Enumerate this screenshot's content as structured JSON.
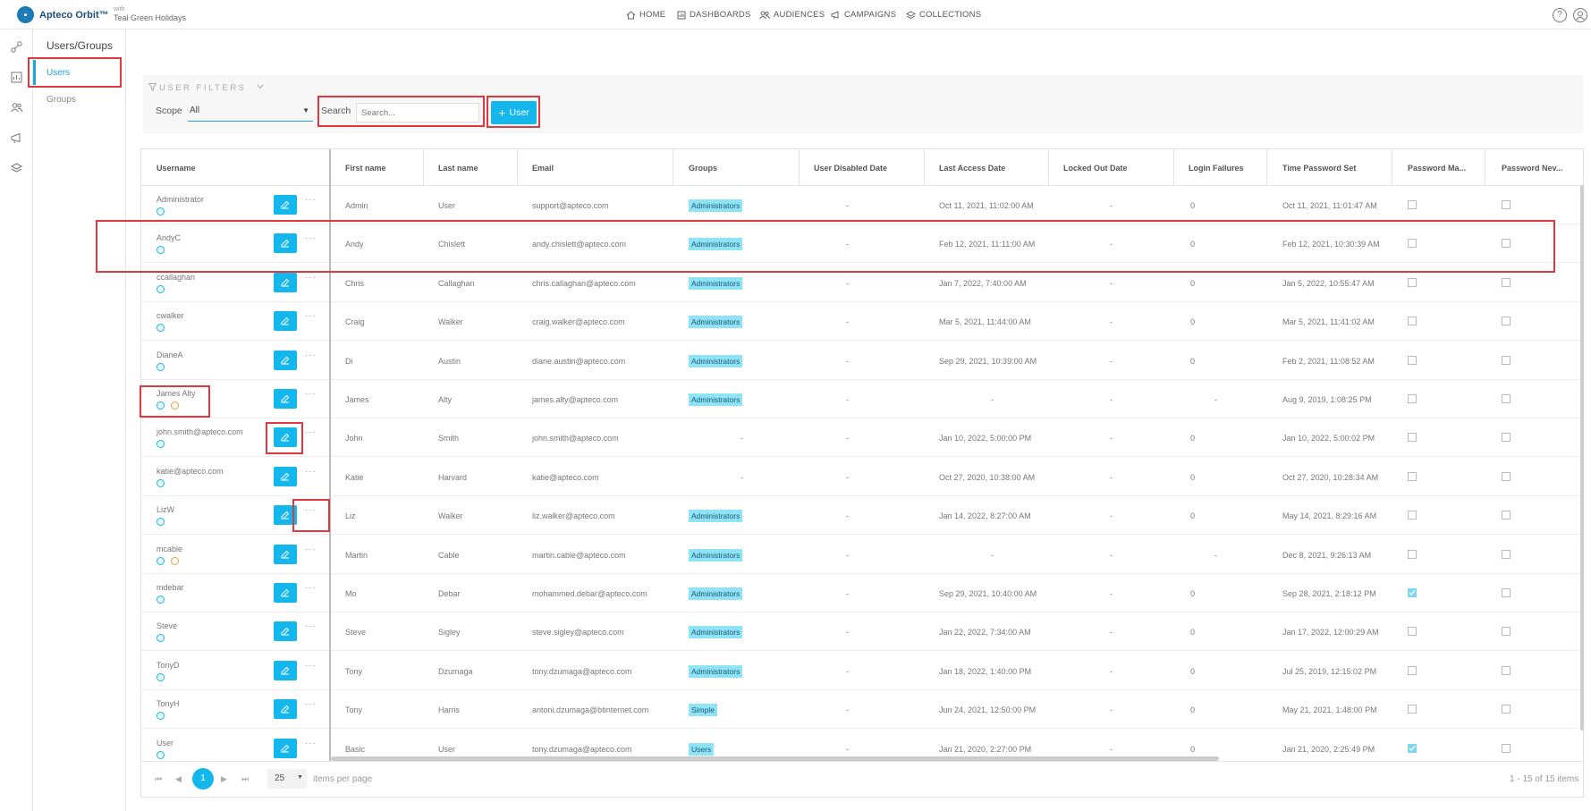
{
  "app": {
    "brand": "Apteco Orbit™",
    "with": "with",
    "company": "Teal Green Holidays"
  },
  "nav": {
    "items": [
      "HOME",
      "DASHBOARDS",
      "AUDIENCES",
      "CAMPAIGNS",
      "COLLECTIONS"
    ]
  },
  "topright": {
    "help": "?"
  },
  "page": {
    "breadcrumb": "Users/Groups",
    "tabs": [
      "Users",
      "Groups"
    ]
  },
  "filters": {
    "title": "USER FILTERS",
    "scope_label": "Scope",
    "scope_value": "All",
    "search_label": "Search",
    "search_placeholder": "Search...",
    "add_button": "User"
  },
  "columns": [
    "Username",
    "First name",
    "Last name",
    "Email",
    "Groups",
    "User Disabled Date",
    "Last Access Date",
    "Locked Out Date",
    "Login Failures",
    "Time Password Set",
    "Password Ma...",
    "Password Nev..."
  ],
  "rows": [
    {
      "username": "Administrator",
      "first": "Admin",
      "last": "User",
      "email": "support@apteco.com",
      "group": "Administrators",
      "disabled": "-",
      "last_access": "Oct 11, 2021, 11:02:00 AM",
      "locked": "-",
      "failures": "0",
      "pw_set": "Oct 11, 2021, 11:01:47 AM",
      "pw_must": false,
      "pw_never": false,
      "info": false
    },
    {
      "username": "AndyC",
      "first": "Andy",
      "last": "Chislett",
      "email": "andy.chislett@apteco.com",
      "group": "Administrators",
      "disabled": "-",
      "last_access": "Feb 12, 2021, 11:11:00 AM",
      "locked": "-",
      "failures": "0",
      "pw_set": "Feb 12, 2021, 10:30:39 AM",
      "pw_must": false,
      "pw_never": false,
      "info": false
    },
    {
      "username": "ccallaghan",
      "first": "Chris",
      "last": "Callaghan",
      "email": "chris.callaghan@apteco.com",
      "group": "Administrators",
      "disabled": "-",
      "last_access": "Jan 7, 2022, 7:40:00 AM",
      "locked": "-",
      "failures": "0",
      "pw_set": "Jan 5, 2022, 10:55:47 AM",
      "pw_must": false,
      "pw_never": false,
      "info": false
    },
    {
      "username": "cwalker",
      "first": "Craig",
      "last": "Walker",
      "email": "craig.walker@apteco.com",
      "group": "Administrators",
      "disabled": "-",
      "last_access": "Mar 5, 2021, 11:44:00 AM",
      "locked": "-",
      "failures": "0",
      "pw_set": "Mar 5, 2021, 11:41:02 AM",
      "pw_must": false,
      "pw_never": false,
      "info": false
    },
    {
      "username": "DianeA",
      "first": "Di",
      "last": "Austin",
      "email": "diane.austin@apteco.com",
      "group": "Administrators",
      "disabled": "-",
      "last_access": "Sep 29, 2021, 10:39:00 AM",
      "locked": "-",
      "failures": "0",
      "pw_set": "Feb 2, 2021, 11:08:52 AM",
      "pw_must": false,
      "pw_never": false,
      "info": false
    },
    {
      "username": "James Alty",
      "first": "James",
      "last": "Alty",
      "email": "james.alty@apteco.com",
      "group": "Administrators",
      "disabled": "-",
      "last_access": "-",
      "locked": "-",
      "failures": "-",
      "pw_set": "Aug 9, 2019, 1:08:25 PM",
      "pw_must": false,
      "pw_never": false,
      "info": true
    },
    {
      "username": "john.smith@apteco.com",
      "first": "John",
      "last": "Smith",
      "email": "john.smith@apteco.com",
      "group": "",
      "group_dash": "-",
      "disabled": "-",
      "last_access": "Jan 10, 2022, 5:00:00 PM",
      "locked": "-",
      "failures": "0",
      "pw_set": "Jan 10, 2022, 5:00:02 PM",
      "pw_must": false,
      "pw_never": false,
      "info": false
    },
    {
      "username": "katie@apteco.com",
      "first": "Katie",
      "last": "Harvard",
      "email": "katie@apteco.com",
      "group": "",
      "group_dash": "-",
      "disabled": "-",
      "last_access": "Oct 27, 2020, 10:38:00 AM",
      "locked": "-",
      "failures": "0",
      "pw_set": "Oct 27, 2020, 10:28:34 AM",
      "pw_must": false,
      "pw_never": false,
      "info": false
    },
    {
      "username": "LizW",
      "first": "Liz",
      "last": "Walker",
      "email": "liz.walker@apteco.com",
      "group": "Administrators",
      "disabled": "-",
      "last_access": "Jan 14, 2022, 8:27:00 AM",
      "locked": "-",
      "failures": "0",
      "pw_set": "May 14, 2021, 8:29:16 AM",
      "pw_must": false,
      "pw_never": false,
      "info": false
    },
    {
      "username": "mcable",
      "first": "Martin",
      "last": "Cable",
      "email": "martin.cable@apteco.com",
      "group": "Administrators",
      "disabled": "-",
      "last_access": "-",
      "locked": "-",
      "failures": "-",
      "pw_set": "Dec 8, 2021, 9:26:13 AM",
      "pw_must": false,
      "pw_never": false,
      "info": true
    },
    {
      "username": "mdebar",
      "first": "Mo",
      "last": "Debar",
      "email": "mohammed.debar@apteco.com",
      "group": "Administrators",
      "disabled": "-",
      "last_access": "Sep 29, 2021, 10:40:00 AM",
      "locked": "-",
      "failures": "0",
      "pw_set": "Sep 28, 2021, 2:18:12 PM",
      "pw_must": true,
      "pw_never": false,
      "info": false
    },
    {
      "username": "Steve",
      "first": "Steve",
      "last": "Sigley",
      "email": "steve.sigley@apteco.com",
      "group": "Administrators",
      "disabled": "-",
      "last_access": "Jan 22, 2022, 7:34:00 AM",
      "locked": "-",
      "failures": "0",
      "pw_set": "Jan 17, 2022, 12:00:29 AM",
      "pw_must": false,
      "pw_never": false,
      "info": false
    },
    {
      "username": "TonyD",
      "first": "Tony",
      "last": "Dzumaga",
      "email": "tony.dzumaga@apteco.com",
      "group": "Administrators",
      "disabled": "-",
      "last_access": "Jan 18, 2022, 1:40:00 PM",
      "locked": "-",
      "failures": "0",
      "pw_set": "Jul 25, 2019, 12:15:02 PM",
      "pw_must": false,
      "pw_never": false,
      "info": false
    },
    {
      "username": "TonyH",
      "first": "Tony",
      "last": "Harris",
      "email": "antoni.dzumaga@btinternet.com",
      "group": "Simple",
      "disabled": "-",
      "last_access": "Jun 24, 2021, 12:50:00 PM",
      "locked": "-",
      "failures": "0",
      "pw_set": "May 21, 2021, 1:48:00 PM",
      "pw_must": false,
      "pw_never": false,
      "info": false
    },
    {
      "username": "User",
      "first": "Basic",
      "last": "User",
      "email": "tony.dzumaga@apteco.com",
      "group": "Users",
      "disabled": "-",
      "last_access": "Jan 21, 2020, 2:27:00 PM",
      "locked": "-",
      "failures": "0",
      "pw_set": "Jan 21, 2020, 2:25:49 PM",
      "pw_must": true,
      "pw_never": false,
      "info": false
    }
  ],
  "pager": {
    "current": "1",
    "page_size": "25",
    "per_page_label": "items per page",
    "summary": "1 - 15 of 15 items",
    "first": "⏮",
    "prev": "◀",
    "next": "▶",
    "last": "⏭"
  },
  "colors": {
    "accent": "#14b7ec",
    "highlight": "#e0383e",
    "badge": "#8fe3f7"
  }
}
